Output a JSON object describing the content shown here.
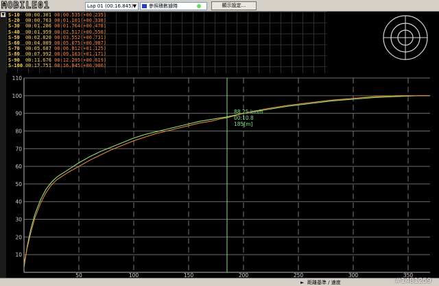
{
  "toolbar": {
    "logo": "MOBILE01",
    "lap_select": "Lap 01   (00:16.845)",
    "data_source": "參照積數據時",
    "display_settings_button": "顯示設定..."
  },
  "splits": [
    {
      "label": "S-10",
      "time": "00:00.301",
      "ref": "00:00.535(+00.235)"
    },
    {
      "label": "S-20",
      "time": "00:00.763",
      "ref": "00:01.101(+00.338)"
    },
    {
      "label": "S-30",
      "time": "00:01.286",
      "ref": "00:01.764(+00.478)"
    },
    {
      "label": "S-40",
      "time": "00:01.959",
      "ref": "00:02.517(+00.558)"
    },
    {
      "label": "S-50",
      "time": "00:02.820",
      "ref": "00:03.552(+00.731)"
    },
    {
      "label": "S-60",
      "time": "00:04.089",
      "ref": "00:05.075(+00.987)"
    },
    {
      "label": "S-70",
      "time": "00:05.687",
      "ref": "00:06.812(+01.125)"
    },
    {
      "label": "S-80",
      "time": "00:07.992",
      "ref": "00:09.163(+01.171)"
    },
    {
      "label": "S-90",
      "time": "00:11.676",
      "ref": "00:12.295(+00.619)"
    },
    {
      "label": "S-100",
      "time": "00:17.751",
      "ref": "00:16.845(+00.906)"
    }
  ],
  "cursor_readout": {
    "speed": "88.25 km/h",
    "time": "00:10.8",
    "distance": "185[m]"
  },
  "status_bar": {
    "axis_mode": "距離基準 / 速度",
    "watermark": "#1481259"
  },
  "colors": {
    "series_green": "#8fe07a",
    "series_orange": "#e6862e",
    "cursor": "#7fe37f",
    "split_label": "#ffd34a",
    "split_ref": "#ff8a3a"
  },
  "chart_data": {
    "type": "line",
    "xlabel": "",
    "ylabel": "",
    "xlim": [
      0,
      370
    ],
    "ylim": [
      0,
      110
    ],
    "x_ticks": [
      50,
      100,
      150,
      200,
      250,
      300,
      350
    ],
    "y_ticks": [
      10,
      20,
      30,
      40,
      50,
      60,
      70,
      80,
      90,
      100,
      110
    ],
    "cursor_x": 185,
    "series": [
      {
        "x": [
          0,
          3,
          6,
          10,
          15,
          20,
          25,
          30,
          40,
          50,
          60,
          70,
          80,
          90,
          100,
          110,
          120,
          130,
          140,
          150,
          160,
          170,
          180,
          185,
          200,
          220,
          240,
          260,
          280,
          300,
          320,
          340,
          360,
          370
        ],
        "values": [
          3,
          15,
          24,
          33,
          41,
          47,
          51,
          54,
          58,
          62,
          65.5,
          68.5,
          71,
          73.5,
          76,
          78,
          79.5,
          81,
          82.5,
          84,
          85.5,
          86.5,
          87.5,
          88,
          90,
          92,
          94,
          95.5,
          97,
          98,
          99,
          99.5,
          100,
          100
        ]
      },
      {
        "x": [
          0,
          3,
          6,
          10,
          15,
          20,
          25,
          30,
          40,
          50,
          60,
          70,
          80,
          90,
          100,
          110,
          120,
          130,
          140,
          150,
          160,
          170,
          180,
          185,
          200,
          220,
          240,
          260,
          280,
          300,
          320,
          340,
          360,
          370
        ],
        "values": [
          5,
          14,
          22,
          31,
          39,
          45,
          49.5,
          52.5,
          56.5,
          60,
          63.5,
          66.5,
          69.5,
          72,
          74.5,
          76.5,
          78.5,
          80,
          81.5,
          83,
          84.5,
          85.5,
          87,
          87.5,
          90,
          92.5,
          94.5,
          96,
          97.5,
          98.5,
          99.5,
          100,
          100,
          100
        ]
      }
    ]
  }
}
